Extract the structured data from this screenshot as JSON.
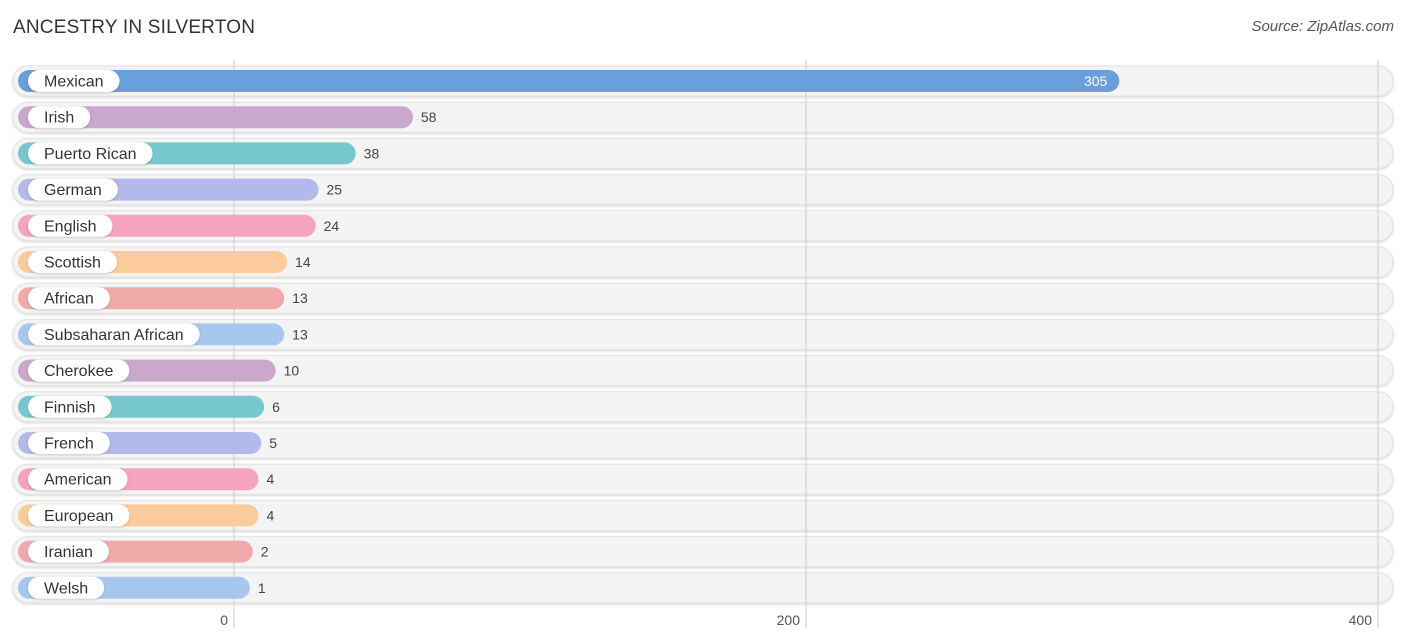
{
  "header": {
    "title": "ANCESTRY IN SILVERTON",
    "source": "Source: ZipAtlas.com"
  },
  "chart_data": {
    "type": "bar",
    "orientation": "horizontal",
    "title": "ANCESTRY IN SILVERTON",
    "xlabel": "",
    "ylabel": "",
    "xlim": [
      0,
      400
    ],
    "x_ticks": [
      "0",
      "200",
      "400"
    ],
    "x_tick_values": [
      0,
      200,
      400
    ],
    "grid": true,
    "categories": [
      "Mexican",
      "Irish",
      "Puerto Rican",
      "German",
      "English",
      "Scottish",
      "African",
      "Subsaharan African",
      "Cherokee",
      "Finnish",
      "French",
      "American",
      "European",
      "Iranian",
      "Welsh"
    ],
    "values": [
      305,
      58,
      38,
      25,
      24,
      14,
      13,
      13,
      10,
      6,
      5,
      4,
      4,
      2,
      1
    ],
    "colors": [
      "#6a9fdb",
      "#c9a8cc",
      "#77c8ce",
      "#b3b9ea",
      "#f5a3bf",
      "#fccb9c",
      "#f0aaaa",
      "#a8c7ec",
      "#c9a8cc",
      "#77c8ce",
      "#b3b9ea",
      "#f5a3bf",
      "#fccb9c",
      "#f0aaaa",
      "#a8c7ec"
    ]
  }
}
